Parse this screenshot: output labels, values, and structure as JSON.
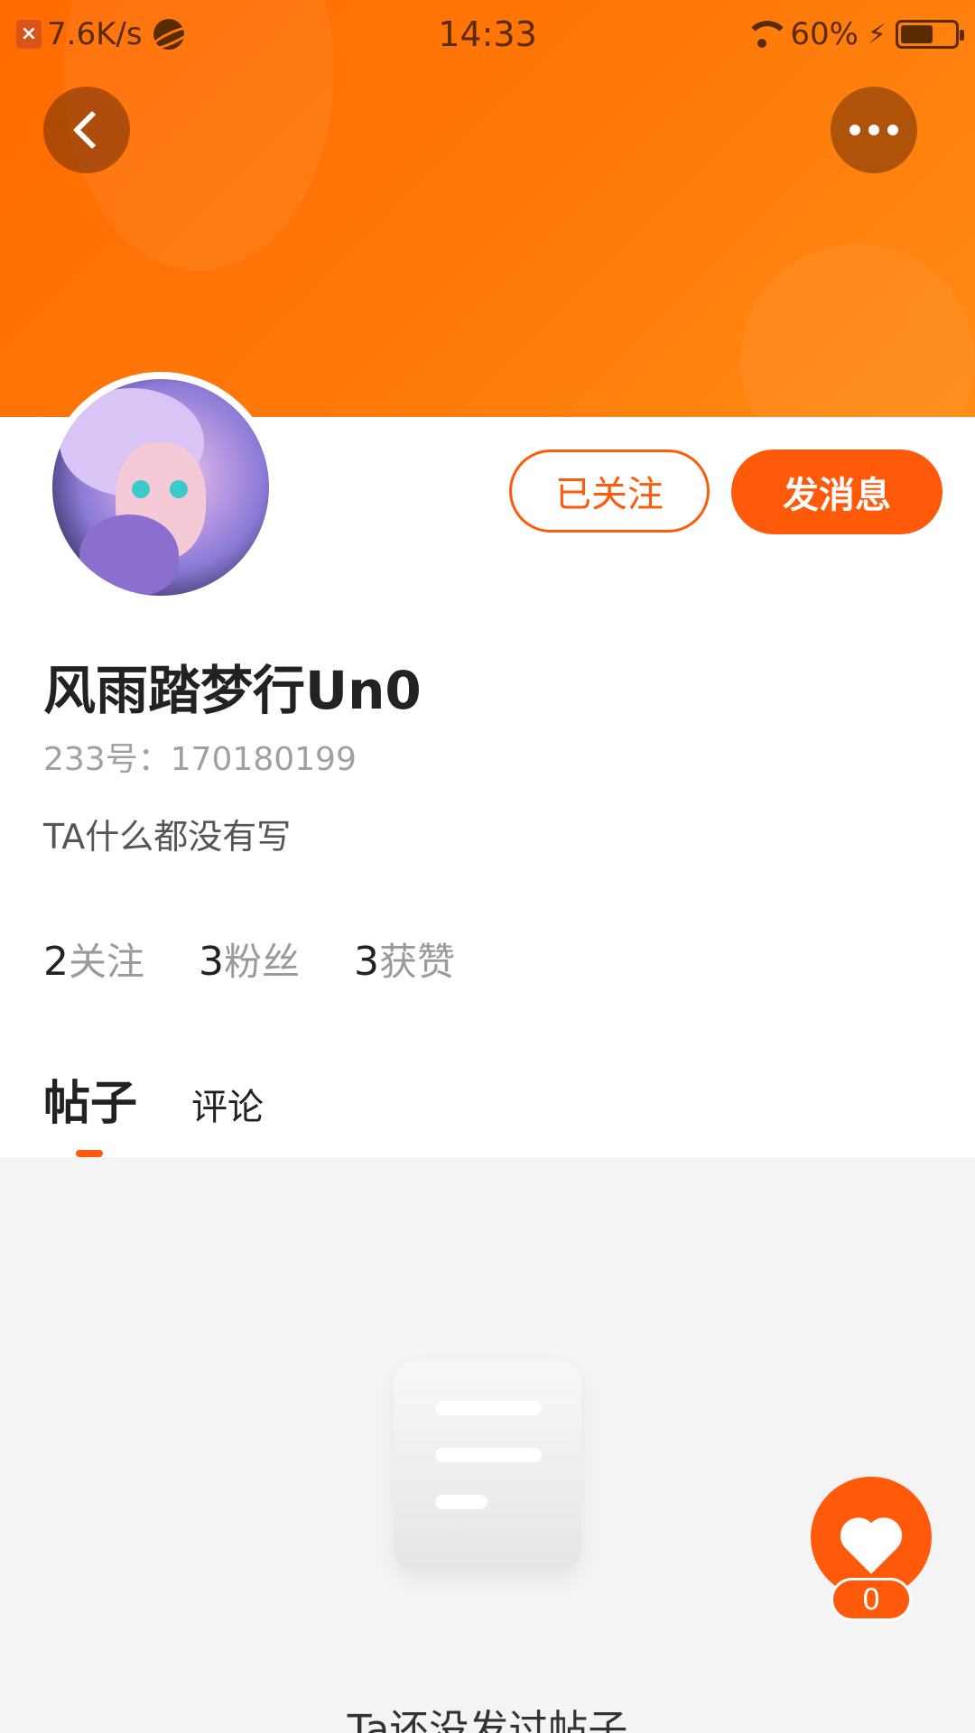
{
  "status_bar": {
    "net_speed": "7.6K/s",
    "time": "14:33",
    "battery": "60%",
    "battery_level": 0.6
  },
  "colors": {
    "accent": "#ff5a0a",
    "banner": "#ff7a0a"
  },
  "header": {
    "back_icon": "chevron-left-icon",
    "more_icon": "more-horizontal-icon"
  },
  "profile": {
    "follow_label": "已关注",
    "message_label": "发消息",
    "username": "风雨踏梦行Un0",
    "uid": "233号：170180199",
    "bio": "TA什么都没有写"
  },
  "stats": [
    {
      "num": "2",
      "label": "关注"
    },
    {
      "num": "3",
      "label": "粉丝"
    },
    {
      "num": "3",
      "label": "获赞"
    }
  ],
  "tabs": {
    "posts": "帖子",
    "comments": "评论"
  },
  "empty_state": {
    "text": "Ta还没发过帖子"
  },
  "like": {
    "count": "0"
  }
}
